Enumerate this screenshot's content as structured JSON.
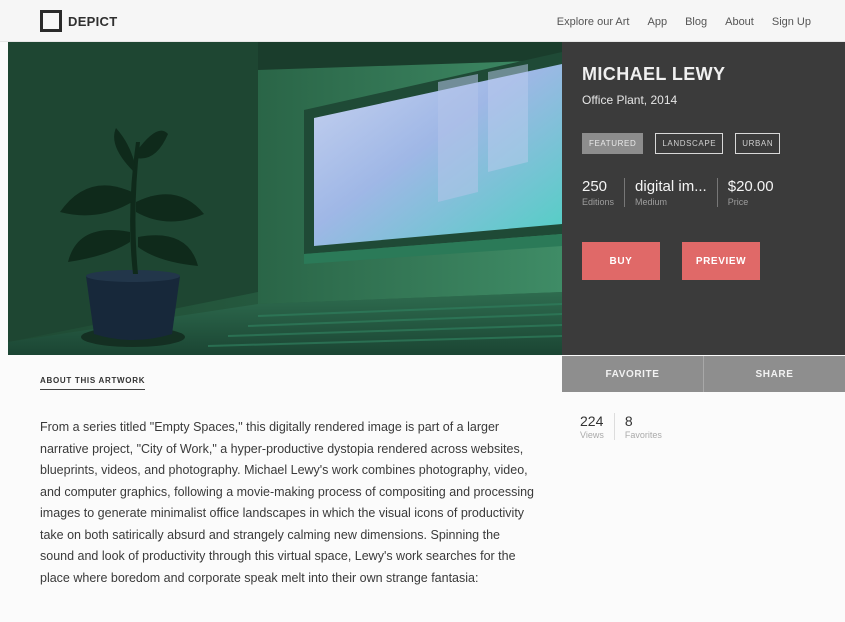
{
  "header": {
    "logo_text": "DEPICT",
    "nav": [
      "Explore our Art",
      "App",
      "Blog",
      "About",
      "Sign Up"
    ]
  },
  "artwork": {
    "artist": "MICHAEL LEWY",
    "title": "Office Plant, 2014",
    "tags": [
      {
        "label": "FEATURED",
        "active": true
      },
      {
        "label": "LANDSCAPE",
        "active": false
      },
      {
        "label": "URBAN",
        "active": false
      }
    ],
    "stats": [
      {
        "value": "250",
        "label": "Editions"
      },
      {
        "value": "digital im...",
        "label": "Medium"
      },
      {
        "value": "$20.00",
        "label": "Price"
      }
    ],
    "buy_label": "BUY",
    "preview_label": "PREVIEW"
  },
  "actions": {
    "favorite_label": "FAVORITE",
    "share_label": "SHARE"
  },
  "counts": [
    {
      "value": "224",
      "label": "Views"
    },
    {
      "value": "8",
      "label": "Favorites"
    }
  ],
  "about": {
    "heading": "ABOUT THIS ARTWORK",
    "text": "From a series titled \"Empty Spaces,\" this digitally rendered image is part of a larger narrative project, \"City of Work,\" a hyper-productive dystopia rendered across websites, blueprints, videos, and photography. Michael Lewy's work combines photography, video, and computer graphics, following a movie-making process of compositing and processing images to generate minimalist office landscapes in which the visual icons of productivity take on both satirically absurd and strangely calming new dimensions. Spinning the sound and look of productivity through this virtual space, Lewy's work searches for the place where boredom and corporate speak melt into their own strange fantasia:"
  },
  "colors": {
    "panel_bg": "#3b3b3b",
    "accent": "#e06968",
    "action_bar": "#8e8e8e"
  }
}
